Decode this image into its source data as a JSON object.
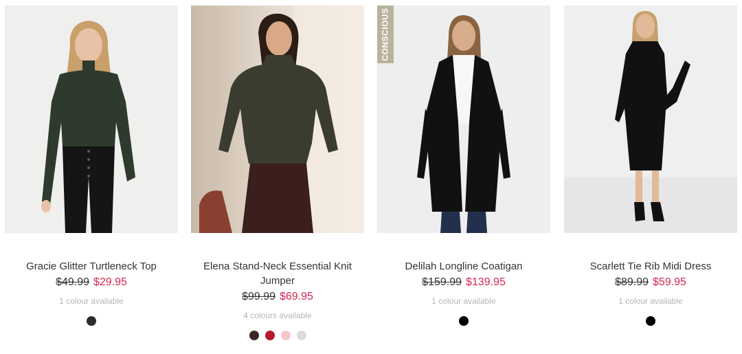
{
  "products": [
    {
      "name": "Gracie Glitter Turtleneck Top",
      "was_price": "$49.99",
      "price": "$29.95",
      "availability": "1 colour available",
      "swatches": [
        "#2b2b2b"
      ],
      "badge": ""
    },
    {
      "name": "Elena Stand-Neck Essential Knit Jumper",
      "was_price": "$99.99",
      "price": "$69.95",
      "availability": "4 colours available",
      "swatches": [
        "#3a2622",
        "#b5182a",
        "#f4c9cc",
        "#dcdcdc"
      ],
      "badge": ""
    },
    {
      "name": "Delilah Longline Coatigan",
      "was_price": "$159.99",
      "price": "$139.95",
      "availability": "1 colour available",
      "swatches": [
        "#000000"
      ],
      "badge": "CONSCIOUS"
    },
    {
      "name": "Scarlett Tie Rib Midi Dress",
      "was_price": "$89.99",
      "price": "$59.95",
      "availability": "1 colour available",
      "swatches": [
        "#000000"
      ],
      "badge": ""
    }
  ]
}
